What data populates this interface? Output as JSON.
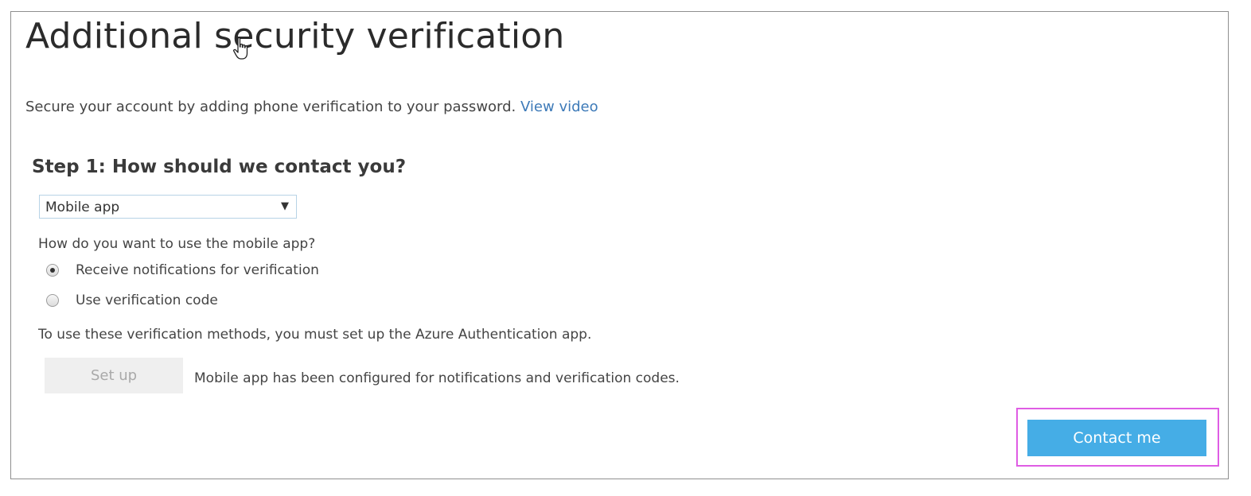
{
  "page": {
    "title": "Additional security verification",
    "subtitle_text": "Secure your account by adding phone verification to your password.",
    "subtitle_link": "View video"
  },
  "step1": {
    "heading": "Step 1: How should we contact you?",
    "method_select": {
      "selected": "Mobile app",
      "arrow": "▼"
    },
    "question": "How do you want to use the mobile app?",
    "options": [
      {
        "label": "Receive notifications for verification",
        "checked": true
      },
      {
        "label": "Use verification code",
        "checked": false
      }
    ],
    "note": "To use these verification methods, you must set up the Azure Authentication app.",
    "setup_button": "Set up",
    "configured_text": "Mobile app has been configured for notifications and verification codes."
  },
  "actions": {
    "contact_button": "Contact me"
  },
  "colors": {
    "link": "#3d7ab8",
    "primary_button": "#45ade6",
    "highlight_border": "#df5de4",
    "disabled_button_bg": "#efefef"
  },
  "icons": {
    "cursor": "hand-pointer-icon",
    "dropdown": "caret-down-icon"
  }
}
